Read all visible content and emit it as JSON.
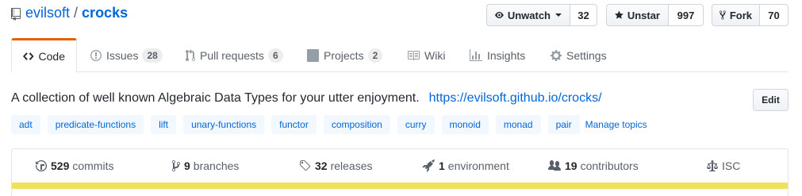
{
  "repo": {
    "owner": "evilsoft",
    "separator": "/",
    "name": "crocks"
  },
  "actions": {
    "watch": {
      "label": "Unwatch",
      "count": "32"
    },
    "star": {
      "label": "Unstar",
      "count": "997"
    },
    "fork": {
      "label": "Fork",
      "count": "70"
    }
  },
  "tabs": [
    {
      "label": "Code",
      "counter": null,
      "icon": "code-icon"
    },
    {
      "label": "Issues",
      "counter": "28",
      "icon": "issue-icon"
    },
    {
      "label": "Pull requests",
      "counter": "6",
      "icon": "pull-request-icon"
    },
    {
      "label": "Projects",
      "counter": "2",
      "icon": "project-icon"
    },
    {
      "label": "Wiki",
      "counter": null,
      "icon": "book-icon"
    },
    {
      "label": "Insights",
      "counter": null,
      "icon": "graph-icon"
    },
    {
      "label": "Settings",
      "counter": null,
      "icon": "gear-icon"
    }
  ],
  "description": {
    "text": "A collection of well known Algebraic Data Types for your utter enjoyment.",
    "link": "https://evilsoft.github.io/crocks/",
    "edit_label": "Edit"
  },
  "topics": [
    "adt",
    "predicate-functions",
    "lift",
    "unary-functions",
    "functor",
    "composition",
    "curry",
    "monoid",
    "monad",
    "pair"
  ],
  "manage_topics": "Manage topics",
  "summary": {
    "commits": {
      "count": "529",
      "label": "commits"
    },
    "branches": {
      "count": "9",
      "label": "branches"
    },
    "releases": {
      "count": "32",
      "label": "releases"
    },
    "environments": {
      "count": "1",
      "label": "environment"
    },
    "contributors": {
      "count": "19",
      "label": "contributors"
    },
    "license": {
      "label": "ISC"
    }
  },
  "colors": {
    "accent": "#e36209",
    "link": "#0366d6",
    "language_bar": "#f1e05a"
  }
}
